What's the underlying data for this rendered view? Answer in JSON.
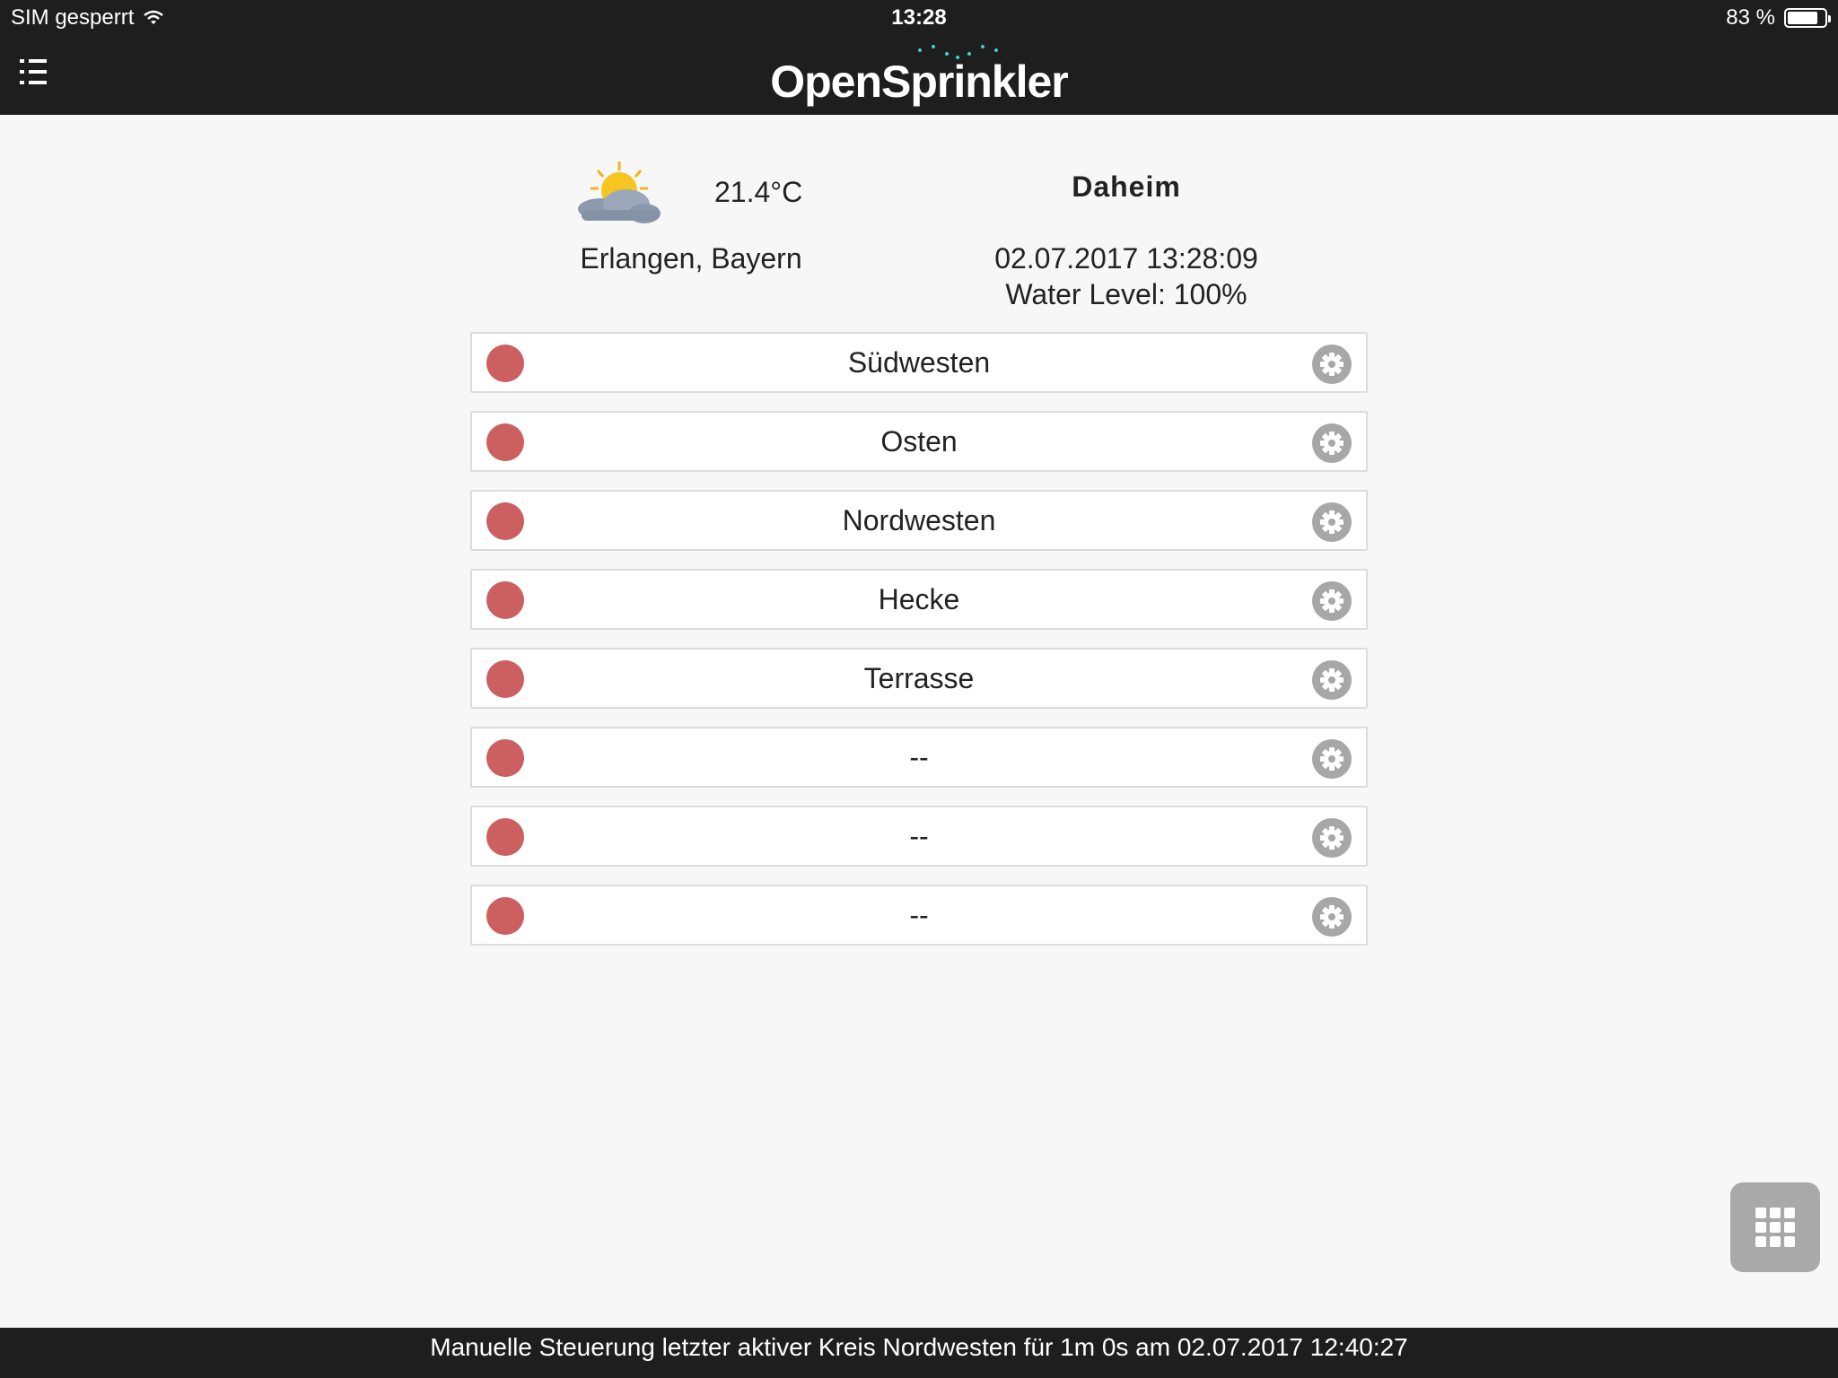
{
  "status_bar": {
    "carrier": "SIM gesperrt",
    "time": "13:28",
    "battery_text": "83 %",
    "battery_level": 0.83
  },
  "header": {
    "logo": "OpenSprinkler",
    "menu_icon": "list-icon"
  },
  "weather": {
    "icon": "partly-cloudy-icon",
    "temperature": "21.4°C",
    "location": "Erlangen, Bayern"
  },
  "site": {
    "name": "Daheim",
    "datetime": "02.07.2017 13:28:09",
    "water_level": "Water Level: 100%"
  },
  "stations": [
    {
      "name": "Südwesten",
      "status": "off"
    },
    {
      "name": "Osten",
      "status": "off"
    },
    {
      "name": "Nordwesten",
      "status": "off"
    },
    {
      "name": "Hecke",
      "status": "off"
    },
    {
      "name": "Terrasse",
      "status": "off"
    },
    {
      "name": "--",
      "status": "off"
    },
    {
      "name": "--",
      "status": "off"
    },
    {
      "name": "--",
      "status": "off"
    }
  ],
  "footer": {
    "message": "Manuelle Steuerung letzter aktiver Kreis Nordwesten für 1m 0s am 02.07.2017 12:40:27"
  },
  "colors": {
    "topbar": "#1e1e1e",
    "background": "#f7f7f7",
    "status_off": "#cc5f5f",
    "gear": "#a7a7a7",
    "accent": "#3fd1c3"
  }
}
